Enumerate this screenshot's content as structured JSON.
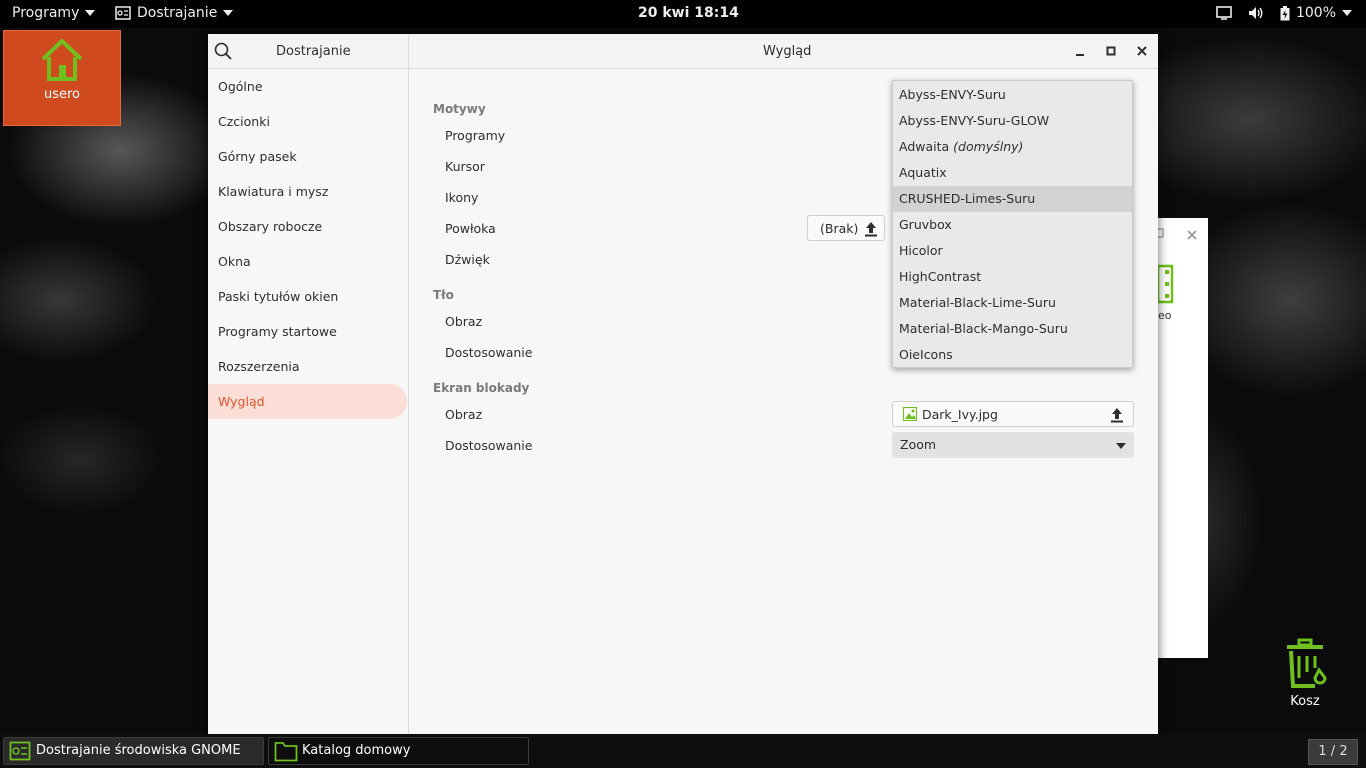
{
  "topbar": {
    "apps_menu": "Programy",
    "active_app": "Dostrajanie",
    "clock": "20 kwi  18:14",
    "battery": "100%"
  },
  "desktop": {
    "home_label": "usero",
    "trash_label": "Kosz",
    "bg_window_fragment_text": "eo"
  },
  "window": {
    "sidebar_title": "Dostrajanie",
    "title": "Wygląd",
    "sidebar_items": [
      {
        "label": "Ogólne"
      },
      {
        "label": "Czcionki"
      },
      {
        "label": "Górny pasek"
      },
      {
        "label": "Klawiatura i mysz"
      },
      {
        "label": "Obszary robocze"
      },
      {
        "label": "Okna"
      },
      {
        "label": "Paski tytułów okien"
      },
      {
        "label": "Programy startowe"
      },
      {
        "label": "Rozszerzenia"
      },
      {
        "label": "Wygląd"
      }
    ],
    "sections": {
      "themes": "Motywy",
      "background": "Tło",
      "lockscreen": "Ekran blokady"
    },
    "rows": {
      "apps": "Programy",
      "cursor": "Kursor",
      "icons": "Ikony",
      "shell": "Powłoka",
      "sound": "Dźwięk",
      "bg_image": "Obraz",
      "bg_adjust": "Dostosowanie",
      "lock_image": "Obraz",
      "lock_adjust": "Dostosowanie"
    },
    "shell_value": "(Brak)",
    "lock_image_value": "Dark_Ivy.jpg",
    "lock_adjust_value": "Zoom",
    "dropdown_items": [
      {
        "label": "Abyss-ENVY-Suru"
      },
      {
        "label": "Abyss-ENVY-Suru-GLOW"
      },
      {
        "label": "Adwaita",
        "suffix": "(domyślny)"
      },
      {
        "label": "Aquatix"
      },
      {
        "label": "CRUSHED-Limes-Suru"
      },
      {
        "label": "Gruvbox"
      },
      {
        "label": "Hicolor"
      },
      {
        "label": "HighContrast"
      },
      {
        "label": "Material-Black-Lime-Suru"
      },
      {
        "label": "Material-Black-Mango-Suru"
      },
      {
        "label": "OieIcons"
      }
    ],
    "dropdown_hover_index": 4
  },
  "taskbar": {
    "tasks": [
      {
        "label": "Dostrajanie środowiska GNOME"
      },
      {
        "label": "Katalog domowy"
      }
    ],
    "pager": "1 / 2"
  },
  "colors": {
    "accent": "#e0532b",
    "accent_bg": "#fbdfd7",
    "icon_green": "#6fbf1f",
    "home_tile": "#d04a1f"
  }
}
